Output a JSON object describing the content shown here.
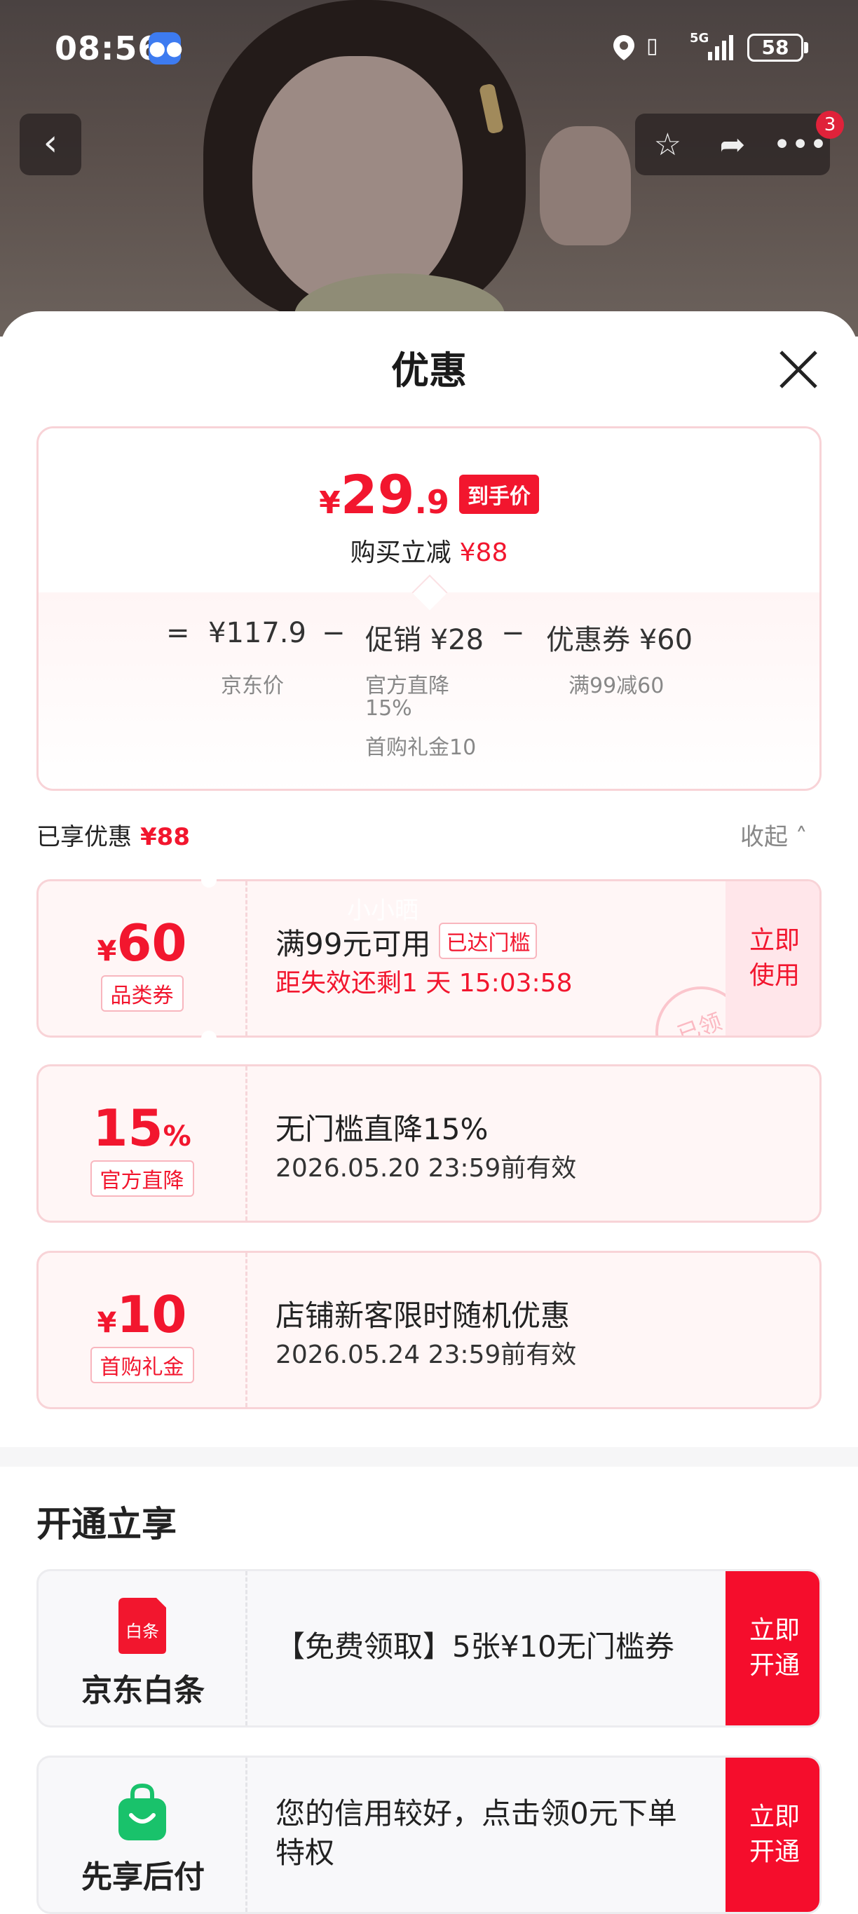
{
  "status_bar": {
    "time": "08:56",
    "network": "5G",
    "battery": "58"
  },
  "top_nav": {
    "notification_count": "3"
  },
  "sheet": {
    "title": "优惠"
  },
  "price_card": {
    "currency": "¥",
    "final_int": "29",
    "final_dec": ".9",
    "final_tag": "到手价",
    "reduce_label": "购买立减",
    "reduce_amount": "¥88",
    "equals": "=",
    "jd_price": "¥117.9",
    "jd_price_label": "京东价",
    "minus1": "−",
    "promo": "促销 ¥28",
    "promo_detail_1": "官方直降",
    "promo_detail_2": "15%",
    "promo_detail_3": "首购礼金10",
    "minus2": "−",
    "coupon": "优惠券 ¥60",
    "coupon_detail": "满99减60"
  },
  "enjoyed": {
    "label": "已享优惠",
    "amount": "¥88",
    "collapse": "收起"
  },
  "coupons": [
    {
      "symbol": "¥",
      "amount": "60",
      "type": "品类券",
      "title": "满99元可用",
      "badge": "已达门槛",
      "subtitle": "距失效还剩1 天 15:03:58",
      "action_1": "立即",
      "action_2": "使用",
      "stamp": "已领",
      "ghost": "小小晒"
    },
    {
      "amount": "15",
      "suffix": "%",
      "type": "官方直降",
      "title": "无门槛直降15%",
      "subtitle": "2026.05.20 23:59前有效"
    },
    {
      "symbol": "¥",
      "amount": "10",
      "type": "首购礼金",
      "title": "店铺新客限时随机优惠",
      "subtitle": "2026.05.24 23:59前有效"
    }
  ],
  "open_section": {
    "title": "开通立享",
    "services": [
      {
        "name": "京东白条",
        "logo_text": "白条",
        "text": "【免费领取】5张¥10无门槛券",
        "action_1": "立即",
        "action_2": "开通"
      },
      {
        "name": "先享后付",
        "text_1": "您的信用较好，点击领0元下单",
        "text_2": "特权",
        "action_1": "立即",
        "action_2": "开通"
      }
    ]
  },
  "colors": {
    "accent_red": "#f2162e",
    "coupon_bg": "#fff6f6"
  }
}
